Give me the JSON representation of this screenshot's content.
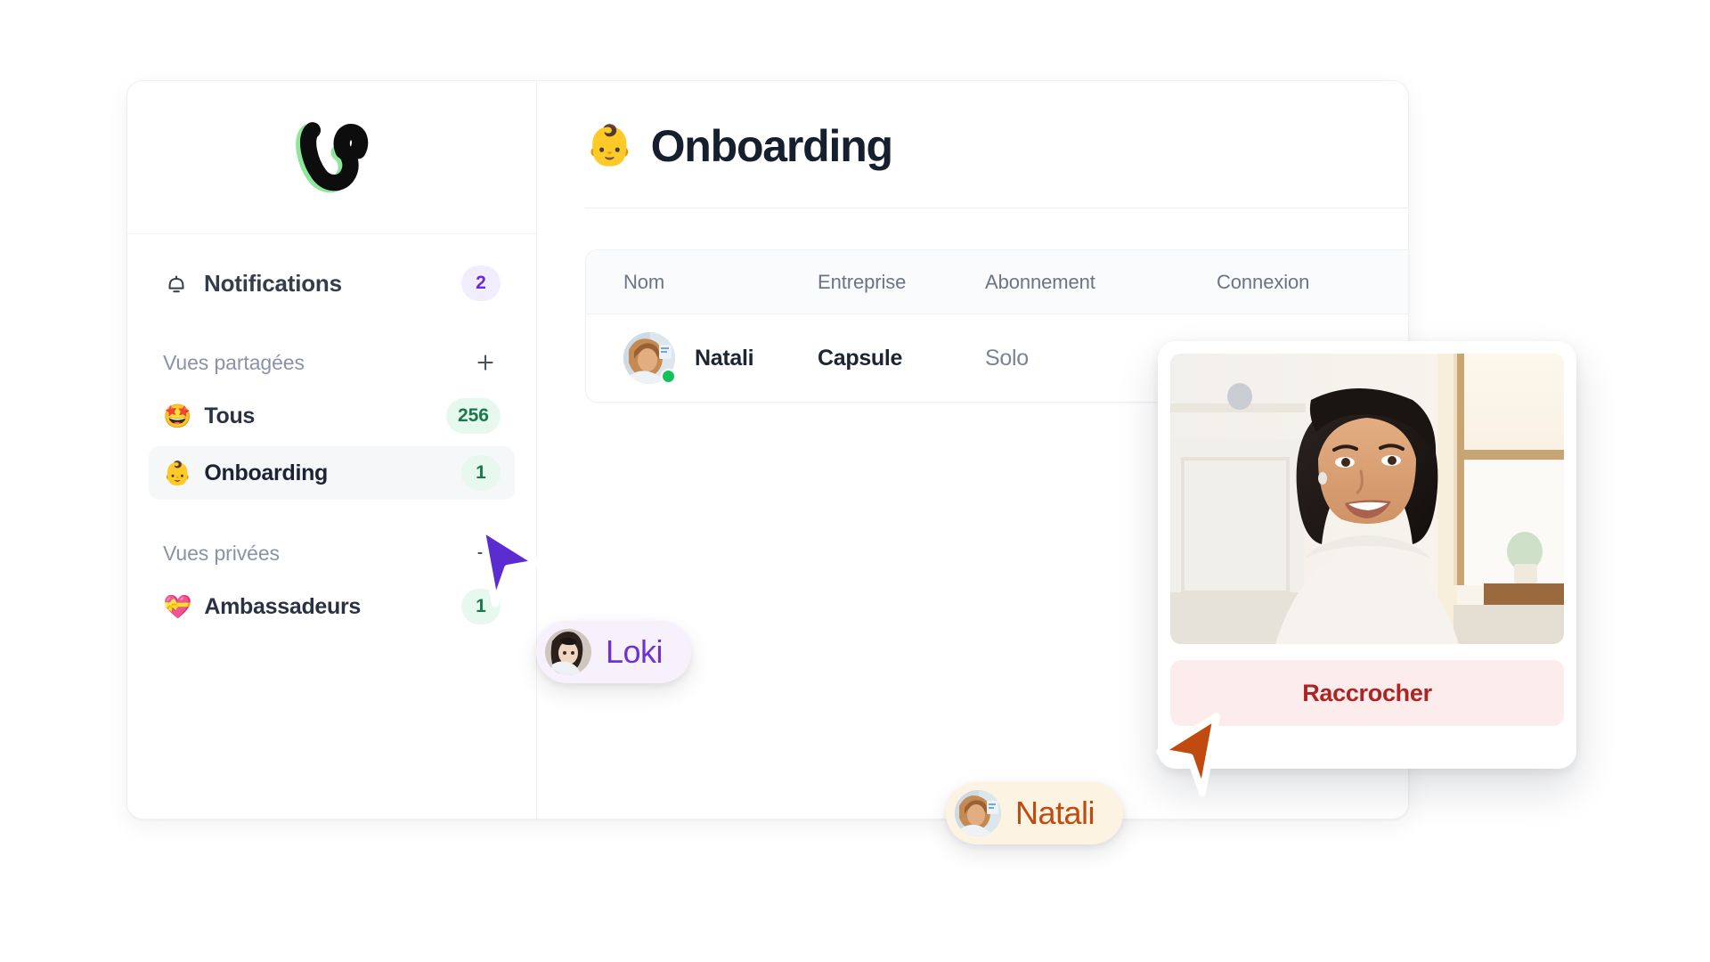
{
  "brand": {
    "logo_icon": "vizio-v-logo",
    "logo_outline_color": "#8ce79a",
    "logo_fill_color": "#0d0d0d"
  },
  "sidebar": {
    "notifications": {
      "icon": "bell-icon",
      "label": "Notifications",
      "badge": "2",
      "badge_color": "#6d28e0",
      "badge_bg": "#f2edfd"
    },
    "sections": [
      {
        "title": "Vues partagées",
        "add_icon": "plus-icon",
        "items": [
          {
            "emoji": "🤩",
            "emoji_name": "star-struck-face-emoji",
            "label": "Tous",
            "badge": "256"
          },
          {
            "emoji": "👶",
            "emoji_name": "baby-emoji",
            "label": "Onboarding",
            "badge": "1",
            "active": true
          }
        ]
      },
      {
        "title": "Vues privées",
        "add_icon": "plus-icon",
        "items": [
          {
            "emoji": "💝",
            "emoji_name": "heart-with-ribbon-emoji",
            "label": "Ambassadeurs",
            "badge": "1"
          }
        ]
      }
    ],
    "badge_green_color": "#17794c",
    "badge_green_bg": "#e7f8ee"
  },
  "main": {
    "title_emoji": "👶",
    "title": "Onboarding",
    "table": {
      "columns": [
        "Nom",
        "Entreprise",
        "Abonnement",
        "Connexion"
      ],
      "rows": [
        {
          "avatar": "natali-avatar",
          "presence": "online",
          "presence_color": "#14c05a",
          "nom": "Natali",
          "entreprise": "Capsule",
          "abonnement": "Solo",
          "connexion": ""
        }
      ]
    }
  },
  "call_card": {
    "video_thumbnail": "video-participant-thumbnail",
    "hangup_label": "Raccrocher",
    "hangup_text_color": "#ae2424",
    "hangup_bg_color": "#fcedec"
  },
  "cursors": [
    {
      "name": "Loki",
      "color": "#5b2dd0",
      "pill_bg": "#f6f1fd",
      "pill_text_color": "#6d33d6",
      "avatar": "loki-avatar"
    },
    {
      "name": "Natali",
      "color": "#c04a10",
      "pill_bg": "#fdf3e2",
      "pill_text_color": "#c04a10",
      "avatar": "natali-avatar"
    }
  ]
}
